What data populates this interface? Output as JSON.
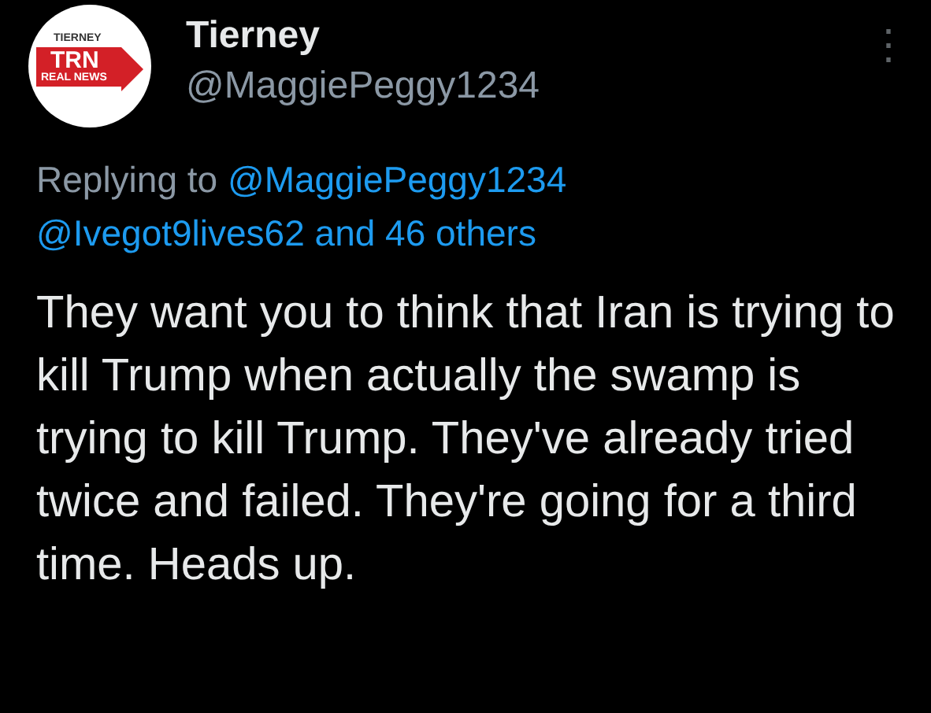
{
  "author": {
    "name": "Tierney",
    "handle": "@MaggiePeggy1234",
    "avatar": {
      "top": "TIERNEY",
      "middle": "TRN",
      "bottom": "REAL NEWS"
    }
  },
  "menu": {
    "glyph": "⋮"
  },
  "reply": {
    "prefix": "Replying to",
    "mentions": [
      "@MaggiePeggy1234",
      "@Ivegot9lives62 and 46 others"
    ]
  },
  "text": "They want you to think that Iran is trying to kill Trump when actually the swamp is trying to kill Trump. They've already tried twice and failed. They're going for a third time. Heads up."
}
